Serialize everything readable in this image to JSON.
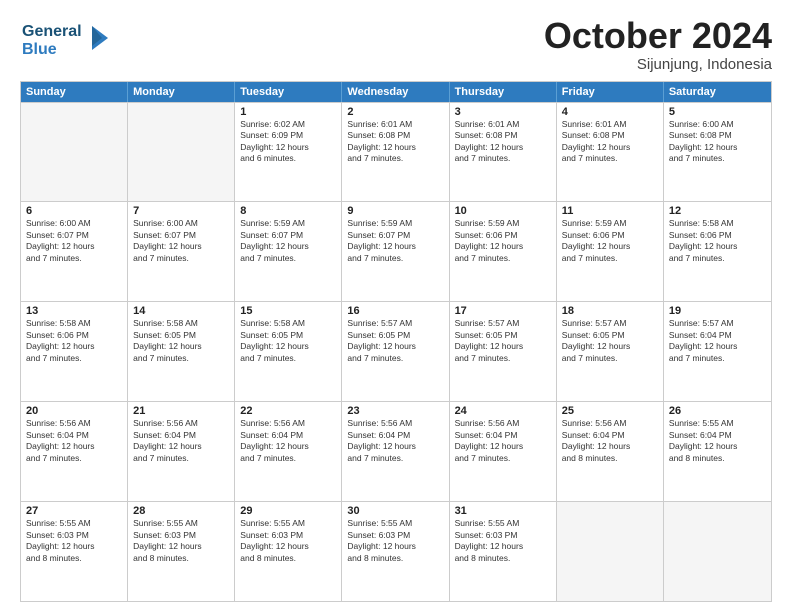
{
  "logo": {
    "line1": "General",
    "line2": "Blue",
    "icon": "▶"
  },
  "title": "October 2024",
  "subtitle": "Sijunjung, Indonesia",
  "header_days": [
    "Sunday",
    "Monday",
    "Tuesday",
    "Wednesday",
    "Thursday",
    "Friday",
    "Saturday"
  ],
  "weeks": [
    [
      {
        "day": "",
        "info": ""
      },
      {
        "day": "",
        "info": ""
      },
      {
        "day": "1",
        "info": "Sunrise: 6:02 AM\nSunset: 6:09 PM\nDaylight: 12 hours\nand 6 minutes."
      },
      {
        "day": "2",
        "info": "Sunrise: 6:01 AM\nSunset: 6:08 PM\nDaylight: 12 hours\nand 7 minutes."
      },
      {
        "day": "3",
        "info": "Sunrise: 6:01 AM\nSunset: 6:08 PM\nDaylight: 12 hours\nand 7 minutes."
      },
      {
        "day": "4",
        "info": "Sunrise: 6:01 AM\nSunset: 6:08 PM\nDaylight: 12 hours\nand 7 minutes."
      },
      {
        "day": "5",
        "info": "Sunrise: 6:00 AM\nSunset: 6:08 PM\nDaylight: 12 hours\nand 7 minutes."
      }
    ],
    [
      {
        "day": "6",
        "info": "Sunrise: 6:00 AM\nSunset: 6:07 PM\nDaylight: 12 hours\nand 7 minutes."
      },
      {
        "day": "7",
        "info": "Sunrise: 6:00 AM\nSunset: 6:07 PM\nDaylight: 12 hours\nand 7 minutes."
      },
      {
        "day": "8",
        "info": "Sunrise: 5:59 AM\nSunset: 6:07 PM\nDaylight: 12 hours\nand 7 minutes."
      },
      {
        "day": "9",
        "info": "Sunrise: 5:59 AM\nSunset: 6:07 PM\nDaylight: 12 hours\nand 7 minutes."
      },
      {
        "day": "10",
        "info": "Sunrise: 5:59 AM\nSunset: 6:06 PM\nDaylight: 12 hours\nand 7 minutes."
      },
      {
        "day": "11",
        "info": "Sunrise: 5:59 AM\nSunset: 6:06 PM\nDaylight: 12 hours\nand 7 minutes."
      },
      {
        "day": "12",
        "info": "Sunrise: 5:58 AM\nSunset: 6:06 PM\nDaylight: 12 hours\nand 7 minutes."
      }
    ],
    [
      {
        "day": "13",
        "info": "Sunrise: 5:58 AM\nSunset: 6:06 PM\nDaylight: 12 hours\nand 7 minutes."
      },
      {
        "day": "14",
        "info": "Sunrise: 5:58 AM\nSunset: 6:05 PM\nDaylight: 12 hours\nand 7 minutes."
      },
      {
        "day": "15",
        "info": "Sunrise: 5:58 AM\nSunset: 6:05 PM\nDaylight: 12 hours\nand 7 minutes."
      },
      {
        "day": "16",
        "info": "Sunrise: 5:57 AM\nSunset: 6:05 PM\nDaylight: 12 hours\nand 7 minutes."
      },
      {
        "day": "17",
        "info": "Sunrise: 5:57 AM\nSunset: 6:05 PM\nDaylight: 12 hours\nand 7 minutes."
      },
      {
        "day": "18",
        "info": "Sunrise: 5:57 AM\nSunset: 6:05 PM\nDaylight: 12 hours\nand 7 minutes."
      },
      {
        "day": "19",
        "info": "Sunrise: 5:57 AM\nSunset: 6:04 PM\nDaylight: 12 hours\nand 7 minutes."
      }
    ],
    [
      {
        "day": "20",
        "info": "Sunrise: 5:56 AM\nSunset: 6:04 PM\nDaylight: 12 hours\nand 7 minutes."
      },
      {
        "day": "21",
        "info": "Sunrise: 5:56 AM\nSunset: 6:04 PM\nDaylight: 12 hours\nand 7 minutes."
      },
      {
        "day": "22",
        "info": "Sunrise: 5:56 AM\nSunset: 6:04 PM\nDaylight: 12 hours\nand 7 minutes."
      },
      {
        "day": "23",
        "info": "Sunrise: 5:56 AM\nSunset: 6:04 PM\nDaylight: 12 hours\nand 7 minutes."
      },
      {
        "day": "24",
        "info": "Sunrise: 5:56 AM\nSunset: 6:04 PM\nDaylight: 12 hours\nand 7 minutes."
      },
      {
        "day": "25",
        "info": "Sunrise: 5:56 AM\nSunset: 6:04 PM\nDaylight: 12 hours\nand 8 minutes."
      },
      {
        "day": "26",
        "info": "Sunrise: 5:55 AM\nSunset: 6:04 PM\nDaylight: 12 hours\nand 8 minutes."
      }
    ],
    [
      {
        "day": "27",
        "info": "Sunrise: 5:55 AM\nSunset: 6:03 PM\nDaylight: 12 hours\nand 8 minutes."
      },
      {
        "day": "28",
        "info": "Sunrise: 5:55 AM\nSunset: 6:03 PM\nDaylight: 12 hours\nand 8 minutes."
      },
      {
        "day": "29",
        "info": "Sunrise: 5:55 AM\nSunset: 6:03 PM\nDaylight: 12 hours\nand 8 minutes."
      },
      {
        "day": "30",
        "info": "Sunrise: 5:55 AM\nSunset: 6:03 PM\nDaylight: 12 hours\nand 8 minutes."
      },
      {
        "day": "31",
        "info": "Sunrise: 5:55 AM\nSunset: 6:03 PM\nDaylight: 12 hours\nand 8 minutes."
      },
      {
        "day": "",
        "info": ""
      },
      {
        "day": "",
        "info": ""
      }
    ]
  ]
}
